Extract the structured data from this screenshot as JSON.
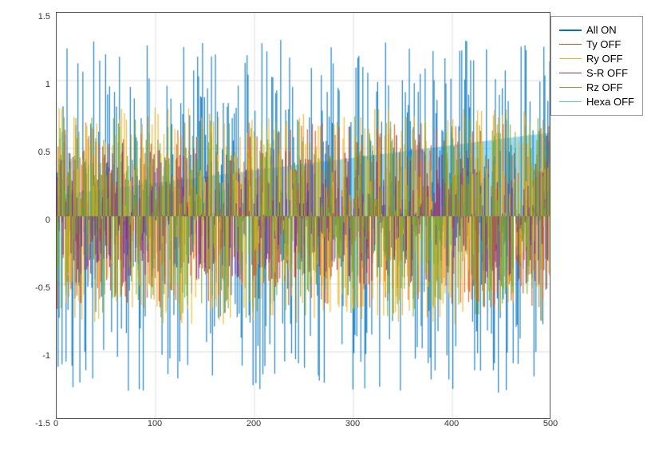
{
  "chart": {
    "title": "",
    "legend": {
      "items": [
        {
          "label": "All ON",
          "color": "#0072BD",
          "lineWidth": 2
        },
        {
          "label": "Ty OFF",
          "color": "#D95319",
          "lineWidth": 1.5
        },
        {
          "label": "Ry OFF",
          "color": "#EDB120",
          "lineWidth": 1.5
        },
        {
          "label": "S-R OFF",
          "color": "#7E2F8E",
          "lineWidth": 1.5
        },
        {
          "label": "Rz OFF",
          "color": "#77AC30",
          "lineWidth": 1.5
        },
        {
          "label": "Hexa OFF",
          "color": "#4DBEEE",
          "lineWidth": 1.5
        }
      ]
    },
    "yAxis": {
      "min": -1.5,
      "max": 1.5,
      "ticks": [
        -1.5,
        -1,
        -0.5,
        0,
        0.5,
        1,
        1.5
      ]
    },
    "xAxis": {
      "min": 0,
      "max": 500,
      "ticks": [
        0,
        100,
        200,
        300,
        400,
        500
      ]
    }
  }
}
